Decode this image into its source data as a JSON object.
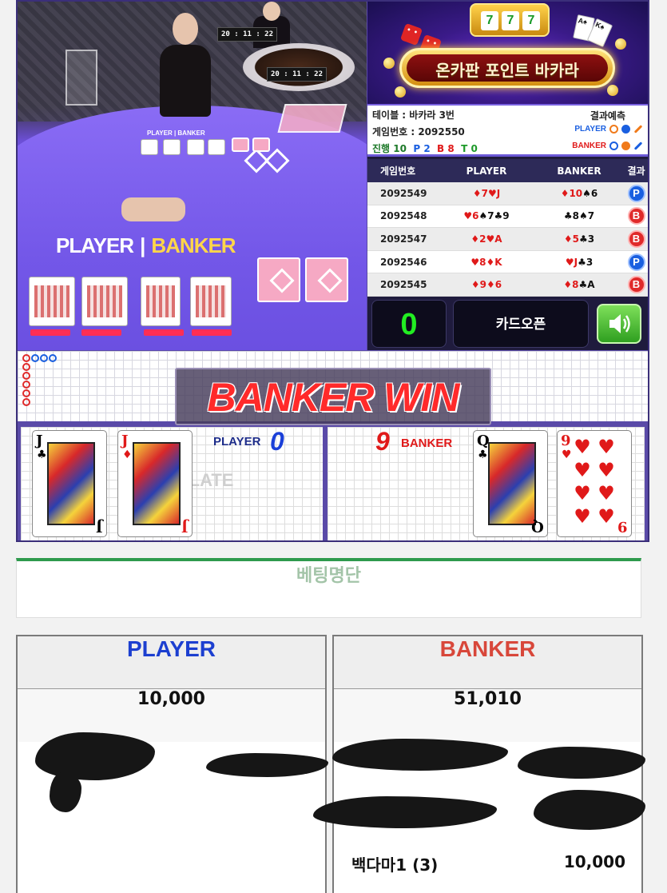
{
  "video": {
    "timer_1": "20 : 11 : 22",
    "timer_2": "20 : 11 : 22",
    "table_label_player": "PLAYER",
    "table_label_banker": "BANKER",
    "mini_label": "PLAYER | BANKER"
  },
  "banner": {
    "reels": [
      "7",
      "7",
      "7"
    ],
    "title": "온카판 포인트 바카라"
  },
  "info": {
    "table": "테이블 : 바카라 3번",
    "game_no": "게임번호 : 2092550",
    "progress_label": "진행",
    "progress_count": "10",
    "p_count": "P 2",
    "b_count": "B 8",
    "t_count": "T 0",
    "prediction_title": "결과예측",
    "pred_player": "PLAYER",
    "pred_banker": "BANKER",
    "colors": {
      "player": "#1a5fe0",
      "banker": "#f07a1a"
    }
  },
  "history": {
    "headers": [
      "게임번호",
      "PLAYER",
      "BANKER",
      "결과"
    ],
    "rows": [
      {
        "game": "2092549",
        "player": [
          [
            "♦",
            "7",
            "red"
          ],
          [
            "♥",
            "J",
            "red"
          ]
        ],
        "banker": [
          [
            "♦",
            "10",
            "red"
          ],
          [
            "♠",
            "6",
            "blk"
          ]
        ],
        "result": "P"
      },
      {
        "game": "2092548",
        "player": [
          [
            "♥",
            "6",
            "red"
          ],
          [
            "♠",
            "7",
            "blk"
          ],
          [
            "♣",
            "9",
            "blk"
          ]
        ],
        "banker": [
          [
            "♣",
            "8",
            "blk"
          ],
          [
            "♠",
            "7",
            "blk"
          ]
        ],
        "result": "B"
      },
      {
        "game": "2092547",
        "player": [
          [
            "♦",
            "2",
            "red"
          ],
          [
            "♥",
            "A",
            "red"
          ]
        ],
        "banker": [
          [
            "♦",
            "5",
            "red"
          ],
          [
            "♣",
            "3",
            "blk"
          ]
        ],
        "result": "B"
      },
      {
        "game": "2092546",
        "player": [
          [
            "♥",
            "8",
            "red"
          ],
          [
            "♦",
            "K",
            "red"
          ]
        ],
        "banker": [
          [
            "♥",
            "J",
            "red"
          ],
          [
            "♣",
            "3",
            "blk"
          ]
        ],
        "result": "P"
      },
      {
        "game": "2092545",
        "player": [
          [
            "♦",
            "9",
            "red"
          ],
          [
            "♦",
            "6",
            "red"
          ]
        ],
        "banker": [
          [
            "♦",
            "8",
            "red"
          ],
          [
            "♣",
            "A",
            "blk"
          ]
        ],
        "result": "B"
      }
    ]
  },
  "controls": {
    "counter": "0",
    "open_cards": "카드오픈",
    "sound_icon": "speaker-icon"
  },
  "outcome": {
    "win_text": "BANKER WIN",
    "player_label": "PLAYER",
    "player_score": "0",
    "banker_label": "BANKER",
    "banker_score": "9",
    "plate_watermark": "PLATE",
    "player_cards": [
      {
        "rank": "J",
        "suit": "♣",
        "color": "#111111"
      },
      {
        "rank": "J",
        "suit": "♦",
        "color": "#e01919"
      }
    ],
    "banker_cards": [
      {
        "rank": "Q",
        "suit": "♣",
        "color": "#111111"
      },
      {
        "rank": "9",
        "suit": "♥",
        "color": "#e01919"
      }
    ]
  },
  "betting": {
    "title": "베팅명단",
    "player_header": "PLAYER",
    "banker_header": "BANKER",
    "player_total": "10,000",
    "banker_total": "51,010",
    "banker_entry_name": "백다마1 (3)",
    "banker_entry_amount": "10,000",
    "colors": {
      "player": "#1c3fd0",
      "banker": "#d8473a"
    }
  }
}
